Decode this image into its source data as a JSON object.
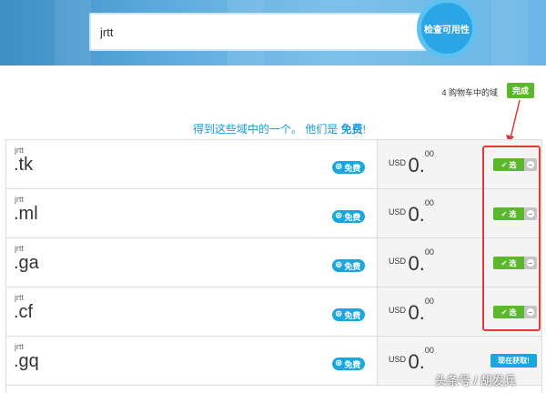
{
  "search": {
    "value": "jrtt",
    "button_label": "检查可用性"
  },
  "cart": {
    "text": "4 购物车中的域",
    "done_label": "完成"
  },
  "promo": {
    "text": "得到这些域中的一个。 他们是 ",
    "free_word": "免费",
    "suffix": "!"
  },
  "rows": [
    {
      "label": "jrtt",
      "tld": ".tk",
      "badge": "免费",
      "currency": "USD",
      "price_int": "0.",
      "price_cents": "00",
      "action": "select",
      "select_label": "选"
    },
    {
      "label": "jrtt",
      "tld": ".ml",
      "badge": "免费",
      "currency": "USD",
      "price_int": "0.",
      "price_cents": "00",
      "action": "select",
      "select_label": "选"
    },
    {
      "label": "jrtt",
      "tld": ".ga",
      "badge": "免费",
      "currency": "USD",
      "price_int": "0.",
      "price_cents": "00",
      "action": "select",
      "select_label": "选"
    },
    {
      "label": "jrtt",
      "tld": ".cf",
      "badge": "免费",
      "currency": "USD",
      "price_int": "0.",
      "price_cents": "00",
      "action": "select",
      "select_label": "选"
    },
    {
      "label": "jrtt",
      "tld": ".gq",
      "badge": "免费",
      "currency": "USD",
      "price_int": "0.",
      "price_cents": "00",
      "action": "get",
      "get_label": "现在获取!"
    }
  ],
  "watermark": "头条号 / 胡发兵",
  "colors": {
    "accent_blue": "#1aa6df",
    "green": "#5cb82b",
    "red_annotation": "#e03a3a"
  }
}
